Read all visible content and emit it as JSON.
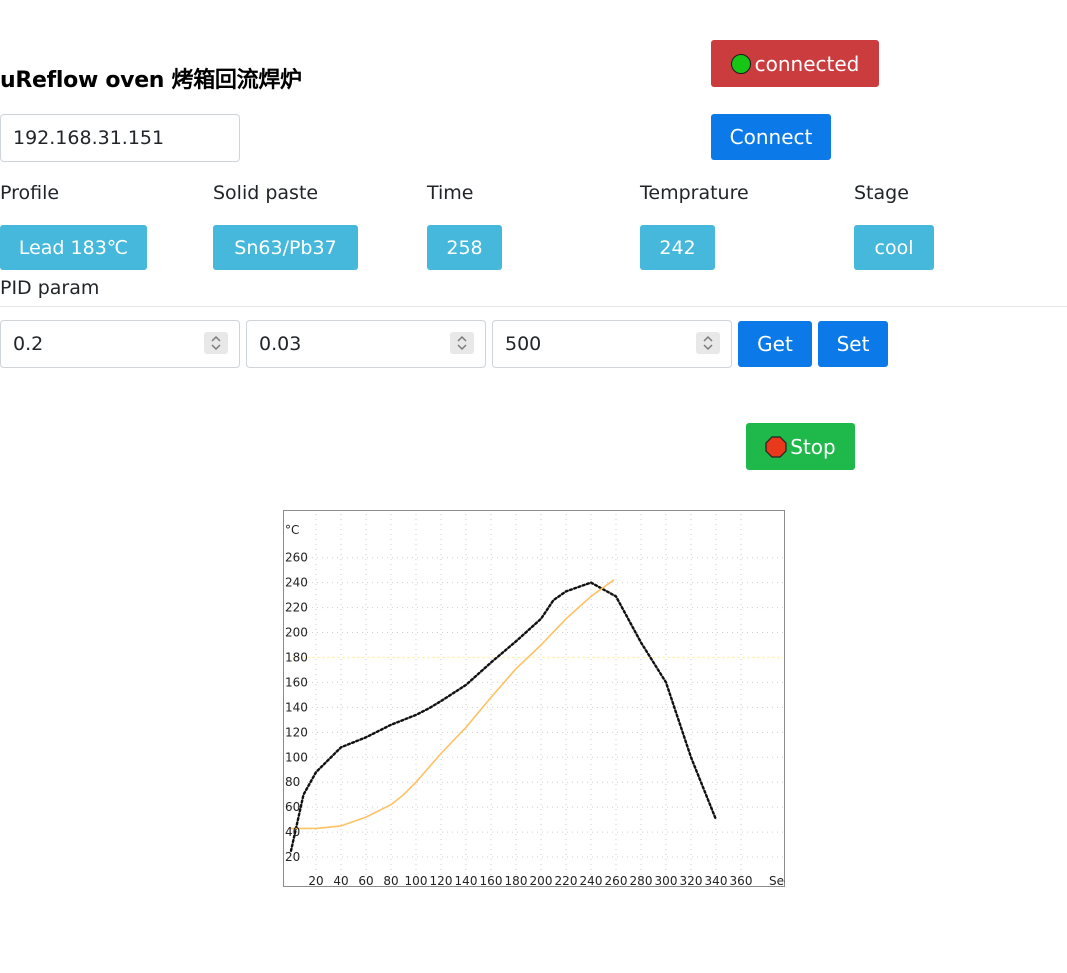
{
  "header": {
    "title": "uReflow oven 烤箱回流焊炉"
  },
  "status": {
    "connected_label": "connected",
    "dot_color": "#17c517"
  },
  "connection": {
    "ip_value": "192.168.31.151",
    "connect_label": "Connect"
  },
  "info": {
    "labels": [
      "Profile",
      "Solid paste",
      "Time",
      "Temprature",
      "Stage"
    ],
    "values": [
      "Lead 183℃",
      "Sn63/Pb37",
      "258",
      "242",
      "cool"
    ]
  },
  "pid": {
    "label": "PID param",
    "values": [
      "0.2",
      "0.03",
      "500"
    ],
    "get_label": "Get",
    "set_label": "Set"
  },
  "stop": {
    "label": "Stop",
    "icon": "stop-sign-icon"
  },
  "colors": {
    "red": "#cb3c3f",
    "blue": "#0b7ae8",
    "green": "#1fb84a",
    "badge": "#45b8db"
  },
  "chart_data": {
    "type": "line",
    "unit_label": "°C",
    "x_unit_label": "Sec",
    "x_ticks": [
      "20",
      "40",
      "60",
      "80",
      "100",
      "120",
      "140",
      "160",
      "180",
      "200",
      "220",
      "240",
      "260",
      "280",
      "300",
      "320",
      "340",
      "360"
    ],
    "y_ticks": [
      "20",
      "40",
      "60",
      "80",
      "100",
      "120",
      "140",
      "160",
      "180",
      "200",
      "220",
      "240",
      "260"
    ],
    "xlim": [
      0,
      380
    ],
    "ylim": [
      0,
      283
    ],
    "grid": true,
    "reference_line": 180,
    "series": [
      {
        "color": "#111111",
        "style": "dotted",
        "x": [
          0,
          10,
          20,
          40,
          60,
          80,
          100,
          110,
          120,
          140,
          160,
          180,
          200,
          210,
          220,
          240,
          260,
          280,
          300,
          320,
          340
        ],
        "y": [
          25,
          70,
          88,
          108,
          116,
          126,
          134,
          139,
          145,
          158,
          176,
          193,
          211,
          226,
          233,
          240,
          229,
          192,
          160,
          100,
          50
        ]
      },
      {
        "color": "#ffc164",
        "style": "solid",
        "x": [
          0,
          20,
          40,
          60,
          80,
          90,
          100,
          120,
          140,
          160,
          180,
          200,
          220,
          240,
          258
        ],
        "y": [
          43,
          43,
          45,
          52,
          62,
          70,
          80,
          103,
          124,
          148,
          171,
          190,
          211,
          229,
          242
        ]
      }
    ]
  }
}
